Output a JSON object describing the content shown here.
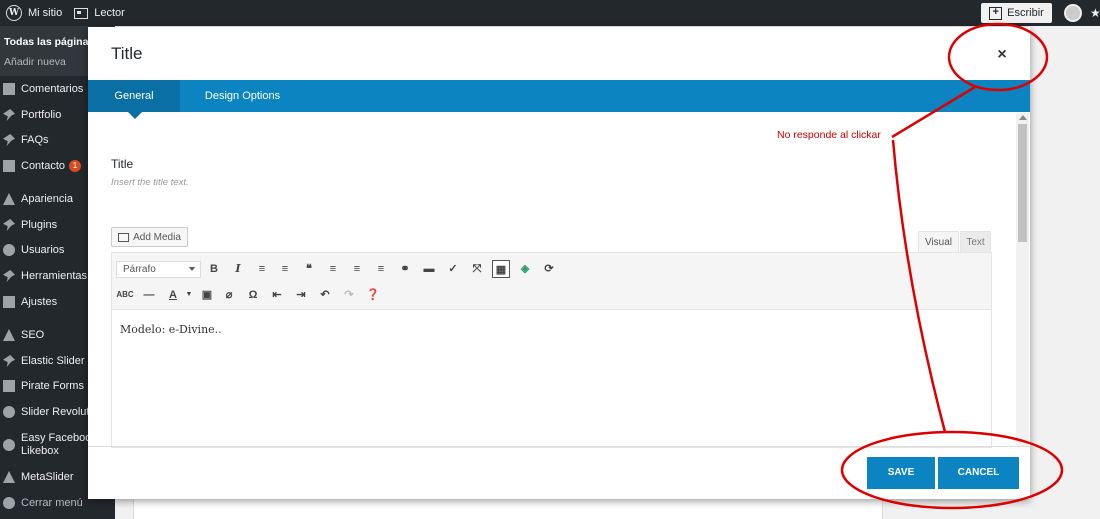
{
  "adminbar": {
    "site_label": "Mi sitio",
    "reader_label": "Lector",
    "write_label": "Escribir"
  },
  "sidebar": {
    "submenu": [
      "Todas las páginas",
      "Añadir nueva"
    ],
    "items": [
      {
        "label": "Comentarios",
        "icon": "comment-icon"
      },
      {
        "label": "Portfolio",
        "icon": "pin-icon"
      },
      {
        "label": "FAQs",
        "icon": "pin-icon"
      },
      {
        "label": "Contacto",
        "icon": "mail-icon",
        "badge": "1"
      },
      {
        "label": "Apariencia",
        "icon": "brush-icon"
      },
      {
        "label": "Plugins",
        "icon": "plug-icon"
      },
      {
        "label": "Usuarios",
        "icon": "user-icon"
      },
      {
        "label": "Herramientas",
        "icon": "wrench-icon"
      },
      {
        "label": "Ajustes",
        "icon": "settings-icon"
      },
      {
        "label": "SEO",
        "icon": "yoast-icon"
      },
      {
        "label": "Elastic Slider",
        "icon": "pin-icon"
      },
      {
        "label": "Pirate Forms",
        "icon": "form-icon"
      },
      {
        "label": "Slider Revoluti",
        "icon": "refresh-icon"
      },
      {
        "label": "Easy Facebook Likebox",
        "icon": "facebook-icon"
      },
      {
        "label": "MetaSlider",
        "icon": "mountain-icon"
      },
      {
        "label": "Cerrar menú",
        "icon": "collapse-icon"
      }
    ]
  },
  "modal": {
    "title": "Title",
    "close_label": "×",
    "tabs": [
      {
        "label": "General",
        "active": true
      },
      {
        "label": "Design Options",
        "active": false
      }
    ],
    "field": {
      "label": "Title",
      "description": "Insert the title text."
    },
    "editor": {
      "add_media_label": "Add Media",
      "tab_visual": "Visual",
      "tab_text": "Text",
      "format_value": "Párrafo",
      "content": "Modelo: e-Divine.."
    },
    "save_label": "SAVE",
    "cancel_label": "CANCEL"
  },
  "annotation": {
    "text": "No responde al clickar",
    "color": "#cc0000"
  },
  "colors": {
    "tab_bar": "#0b84c1",
    "tab_active": "#0a6fa4",
    "button": "#0b84c1",
    "admin_dark": "#23282d",
    "badge": "#d54e21"
  }
}
